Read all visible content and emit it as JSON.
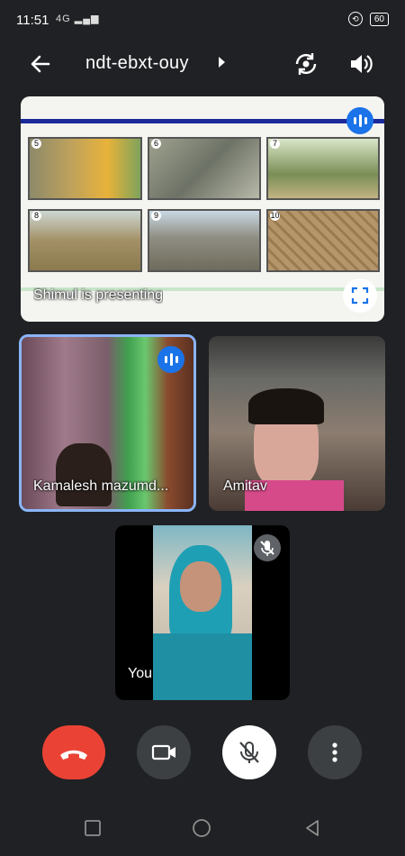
{
  "status": {
    "time": "11:51",
    "signal": "4G",
    "battery": "60"
  },
  "meeting": {
    "code": "ndt-ebxt-ouy"
  },
  "presentation": {
    "label": "Shimul is presenting",
    "slide_numbers": [
      "5",
      "6",
      "7",
      "8",
      "9",
      "10"
    ]
  },
  "participants": [
    {
      "name": "Kamalesh mazumd...",
      "speaking": true
    },
    {
      "name": "Amitav",
      "speaking": false
    },
    {
      "name": "You",
      "muted": true
    }
  ],
  "icons": {
    "back": "arrow-left-icon",
    "switch_camera": "switch-camera-icon",
    "speaker": "speaker-icon",
    "fullscreen": "fullscreen-icon",
    "end_call": "phone-hangup-icon",
    "camera": "video-camera-icon",
    "mic": "mic-off-icon",
    "more": "more-vertical-icon"
  },
  "colors": {
    "background": "#202124",
    "accent": "#1a73e8",
    "end_call": "#ea4335",
    "speaking_border": "#8ab4f8"
  }
}
